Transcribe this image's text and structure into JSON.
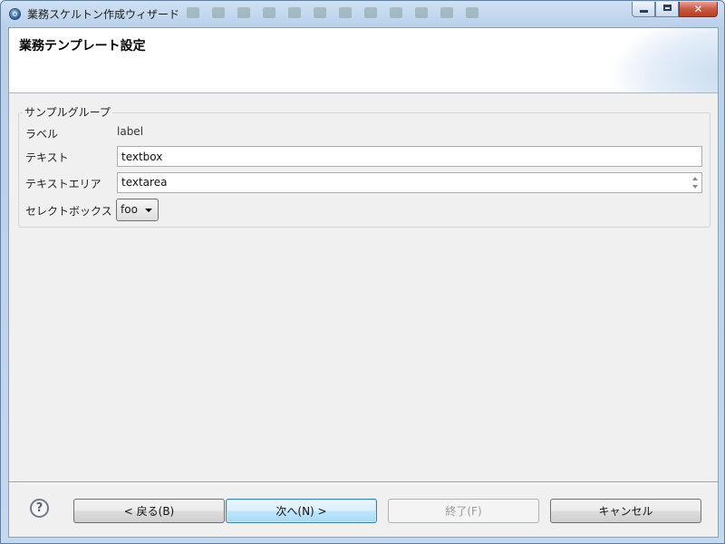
{
  "window": {
    "title": "業務スケルトン作成ウィザード",
    "caption_buttons": {
      "minimize": "minimize",
      "maximize": "maximize",
      "close": "✕"
    }
  },
  "header": {
    "title": "業務テンプレート設定"
  },
  "group": {
    "legend": "サンプルグループ",
    "rows": {
      "label": {
        "label": "ラベル",
        "value": "label"
      },
      "text": {
        "label": "テキスト",
        "value": "textbox"
      },
      "textarea": {
        "label": "テキストエリア",
        "value": "textarea"
      },
      "select": {
        "label": "セレクトボックス",
        "value": "foo"
      }
    }
  },
  "footer": {
    "help": "?",
    "back": "< 戻る(B)",
    "next": "次へ(N) >",
    "finish": "終了(F)",
    "cancel": "キャンセル"
  },
  "colors": {
    "primary_button_border": "#3c7fb1",
    "close_button": "#c85a43"
  }
}
